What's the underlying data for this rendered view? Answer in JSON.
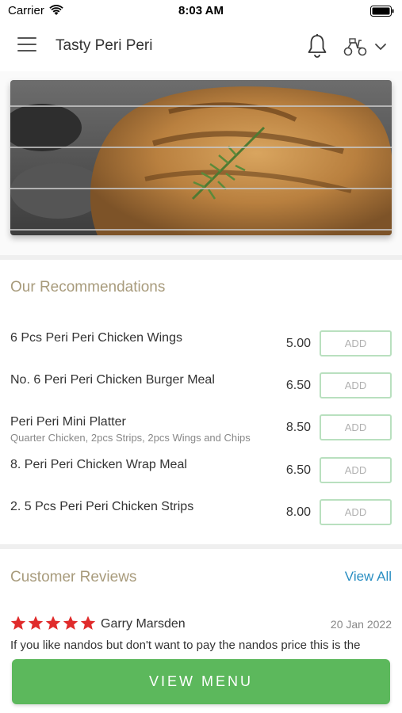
{
  "status_bar": {
    "carrier": "Carrier",
    "time": "8:03 AM"
  },
  "header": {
    "title": "Tasty Peri Peri"
  },
  "hero": {
    "alt": "Grilled peri peri chicken"
  },
  "recommendations": {
    "title": "Our Recommendations",
    "add_label": "ADD",
    "items": [
      {
        "name": "6 Pcs Peri Peri Chicken Wings",
        "description": "",
        "price": "5.00"
      },
      {
        "name": "No. 6 Peri Peri Chicken Burger Meal",
        "description": "",
        "price": "6.50"
      },
      {
        "name": "Peri Peri Mini Platter",
        "description": "Quarter Chicken, 2pcs Strips, 2pcs Wings and Chips",
        "price": "8.50"
      },
      {
        "name": "8. Peri Peri Chicken Wrap Meal",
        "description": "",
        "price": "6.50"
      },
      {
        "name": "2. 5 Pcs Peri Peri Chicken Strips",
        "description": "",
        "price": "8.00"
      }
    ]
  },
  "reviews": {
    "title": "Customer Reviews",
    "view_all": "View All",
    "items": [
      {
        "reviewer": "Garry Marsden",
        "date": "20 Jan 2022",
        "rating": 5,
        "text": "If you like nandos but don't want to pay the nandos price this is the"
      }
    ]
  },
  "cta": {
    "label": "VIEW MENU"
  },
  "colors": {
    "accent_green": "#5cb85c",
    "section_title": "#a89b7c",
    "link_blue": "#2a8ec2",
    "star_red": "#e02b2b"
  }
}
